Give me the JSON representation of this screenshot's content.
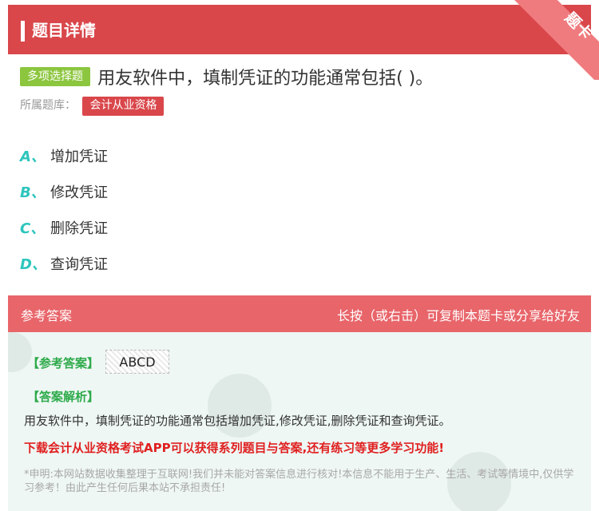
{
  "header": {
    "title": "题目详情",
    "corner_label": "题卡"
  },
  "question": {
    "type_badge": "多项选择题",
    "text": "用友软件中，填制凭证的功能通常包括( )。",
    "source_label": "所属题库：",
    "source_badge": "会计从业资格"
  },
  "options": [
    {
      "letter": "A、",
      "text": "增加凭证"
    },
    {
      "letter": "B、",
      "text": "修改凭证"
    },
    {
      "letter": "C、",
      "text": "删除凭证"
    },
    {
      "letter": "D、",
      "text": "查询凭证"
    }
  ],
  "answer": {
    "title": "参考答案",
    "hint": "长按（或右击）可复制本题卡或分享给好友",
    "ref_label": "【参考答案】",
    "ref_value": "ABCD",
    "analysis_label": "【答案解析】",
    "analysis_text": "用友软件中，填制凭证的功能通常包括增加凭证,修改凭证,删除凭证和查询凭证。",
    "promo": "下载会计从业资格考试APP可以获得系列题目与答案,还有练习等更多学习功能!",
    "disclaimer": "*申明:本网站数据收集整理于互联网!我们并未能对答案信息进行核对!本信息不能用于生产、生活、考试等情境中,仅供学习参考！由此产生任何后果本站不承担责任!"
  },
  "colors": {
    "header": "#d9474b",
    "answer_header": "#e8656a",
    "type_badge": "#8cc63f",
    "option_letter": "#2ec5bd",
    "answer_label": "#2daa4a",
    "promo": "#e02020"
  }
}
